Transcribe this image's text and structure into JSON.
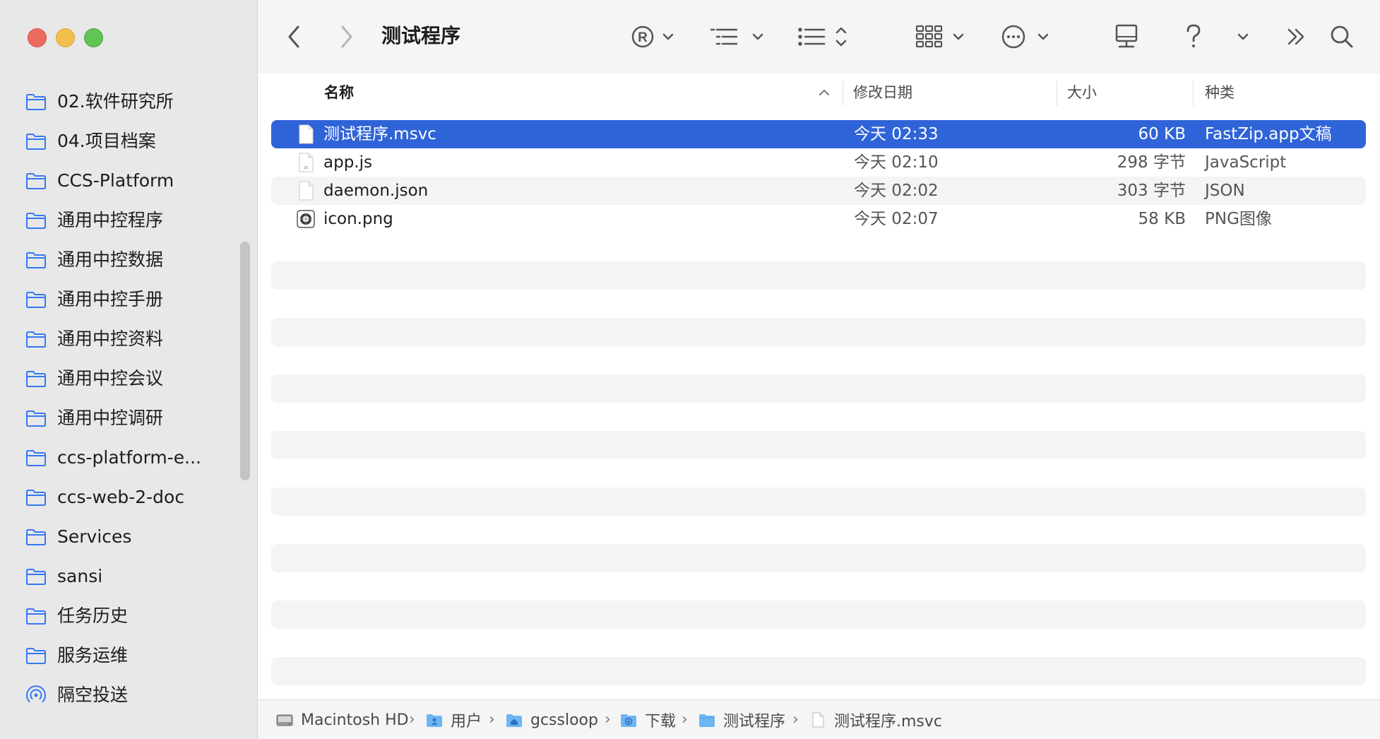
{
  "sidebar": {
    "items": [
      {
        "label": "02.软件研究所",
        "icon": "folder-icon"
      },
      {
        "label": "04.项目档案",
        "icon": "folder-icon"
      },
      {
        "label": "CCS-Platform",
        "icon": "folder-icon"
      },
      {
        "label": "通用中控程序",
        "icon": "folder-icon"
      },
      {
        "label": "通用中控数据",
        "icon": "folder-icon"
      },
      {
        "label": "通用中控手册",
        "icon": "folder-icon"
      },
      {
        "label": "通用中控资料",
        "icon": "folder-icon"
      },
      {
        "label": "通用中控会议",
        "icon": "folder-icon"
      },
      {
        "label": "通用中控调研",
        "icon": "folder-icon"
      },
      {
        "label": "ccs-platform-e...",
        "icon": "folder-icon"
      },
      {
        "label": "ccs-web-2-doc",
        "icon": "folder-icon"
      },
      {
        "label": "Services",
        "icon": "folder-icon"
      },
      {
        "label": "sansi",
        "icon": "folder-icon"
      },
      {
        "label": "任务历史",
        "icon": "folder-icon"
      },
      {
        "label": "服务运维",
        "icon": "folder-icon"
      },
      {
        "label": "隔空投送",
        "icon": "airdrop-icon"
      }
    ]
  },
  "toolbar": {
    "title": "测试程序"
  },
  "columns": {
    "name": "名称",
    "date": "修改日期",
    "size": "大小",
    "kind": "种类"
  },
  "files": [
    {
      "name": "测试程序.msvc",
      "date": "今天 02:33",
      "size": "60 KB",
      "kind": "FastZip.app文稿",
      "icon": "document-icon",
      "selected": true
    },
    {
      "name": "app.js",
      "date": "今天 02:10",
      "size": "298 字节",
      "kind": "JavaScript",
      "icon": "js-file-icon",
      "selected": false
    },
    {
      "name": "daemon.json",
      "date": "今天 02:02",
      "size": "303 字节",
      "kind": "JSON",
      "icon": "document-icon",
      "selected": false
    },
    {
      "name": "icon.png",
      "date": "今天 02:07",
      "size": "58 KB",
      "kind": "PNG图像",
      "icon": "image-file-icon",
      "selected": false
    }
  ],
  "pathbar": {
    "crumbs": [
      {
        "label": "Macintosh HD",
        "icon": "hard-drive-icon"
      },
      {
        "label": "用户",
        "icon": "users-folder-icon"
      },
      {
        "label": "gcssloop",
        "icon": "home-folder-icon"
      },
      {
        "label": "下载",
        "icon": "downloads-folder-icon"
      },
      {
        "label": "测试程序",
        "icon": "folder-icon"
      },
      {
        "label": "测试程序.msvc",
        "icon": "document-icon"
      }
    ]
  },
  "colors": {
    "accent": "#2f63d8",
    "sidebar_bg": "#e8e8e8",
    "folder_icon": "#3478f6",
    "stripe": "#f4f4f4"
  }
}
